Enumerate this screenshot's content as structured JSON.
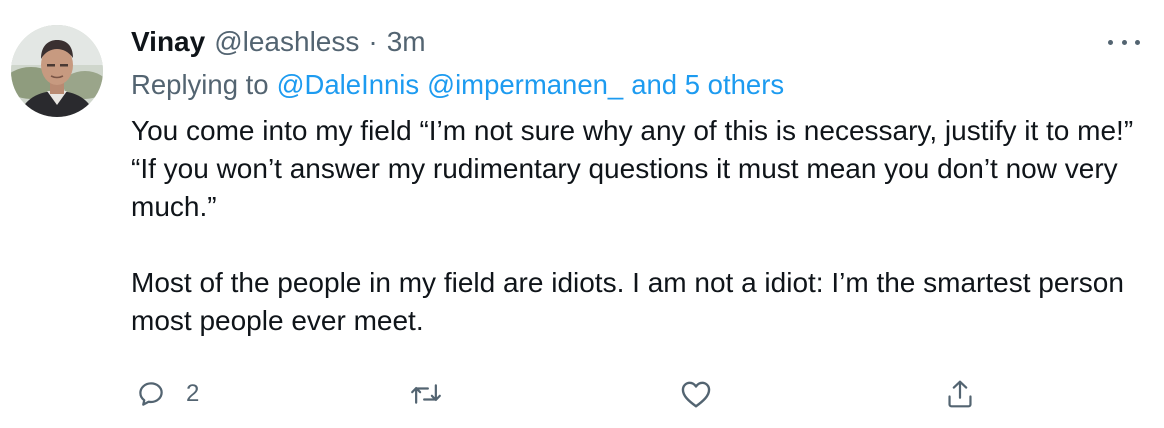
{
  "tweet": {
    "author": {
      "name": "Vinay",
      "handle": "@leashless",
      "avatar_icon": "profile-photo"
    },
    "separator": "·",
    "time": "3m",
    "more_icon": "more-horizontal-icon",
    "replying": {
      "prefix": "Replying to",
      "mention_1": "@DaleInnis",
      "mention_2": "@impermanen_",
      "others": "and 5 others"
    },
    "body": {
      "paragraph_1": "You come into my field “I’m not sure why any of this is necessary, justify it to me!” “If you won’t answer my rudimentary questions it must mean you don’t now very much.”",
      "paragraph_2": "Most of the people in my field are idiots. I am not a idiot: I’m the smartest person most people ever meet."
    },
    "actions": {
      "reply": {
        "icon": "reply-icon",
        "count": "2"
      },
      "retweet": {
        "icon": "retweet-icon"
      },
      "like": {
        "icon": "heart-icon"
      },
      "share": {
        "icon": "share-icon"
      }
    }
  },
  "colors": {
    "text": "#0f1419",
    "secondary": "#536471",
    "link": "#1d9bf0",
    "background": "#ffffff"
  }
}
